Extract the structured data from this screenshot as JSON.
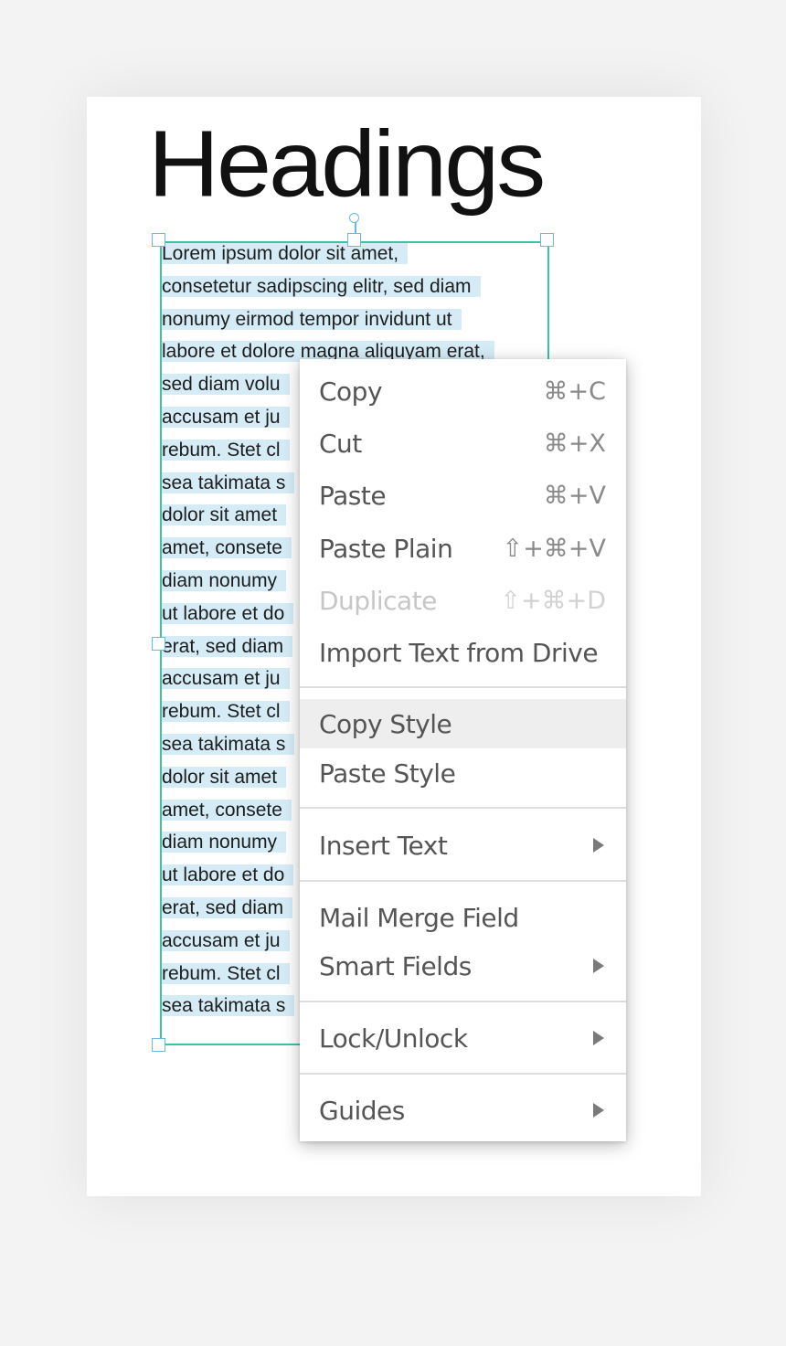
{
  "heading": "Headings",
  "body_lines": [
    "Lorem ipsum dolor sit amet,",
    "consetetur sadipscing elitr, sed diam",
    "nonumy eirmod tempor invidunt ut",
    "labore et dolore magna aliquyam erat,",
    "sed diam volu",
    "accusam et ju",
    "rebum. Stet cl",
    "sea takimata s",
    "dolor sit amet",
    "amet, consete",
    "diam nonumy",
    "ut labore et do",
    "erat, sed diam",
    "accusam et ju",
    "rebum. Stet cl",
    "sea takimata s",
    "dolor sit amet",
    "amet, consete",
    "diam nonumy",
    "ut labore et do",
    "erat, sed diam",
    "accusam et ju",
    "rebum. Stet cl",
    "sea takimata s"
  ],
  "context_menu": {
    "copy": {
      "label": "Copy",
      "shortcut": "⌘+C"
    },
    "cut": {
      "label": "Cut",
      "shortcut": "⌘+X"
    },
    "paste": {
      "label": "Paste",
      "shortcut": "⌘+V"
    },
    "paste_plain": {
      "label": "Paste Plain",
      "shortcut": "⇧+⌘+V"
    },
    "duplicate": {
      "label": "Duplicate",
      "shortcut": "⇧+⌘+D",
      "disabled": true
    },
    "import_text": {
      "label": "Import Text from Drive"
    },
    "copy_style": {
      "label": "Copy Style",
      "highlighted": true
    },
    "paste_style": {
      "label": "Paste Style"
    },
    "insert_text": {
      "label": "Insert Text",
      "submenu": true
    },
    "mail_merge": {
      "label": "Mail Merge Field"
    },
    "smart_fields": {
      "label": "Smart Fields",
      "submenu": true
    },
    "lock_unlock": {
      "label": "Lock/Unlock",
      "submenu": true
    },
    "guides": {
      "label": "Guides",
      "submenu": true
    }
  },
  "colors": {
    "selection_border": "#3ec3a2",
    "text_highlight": "#d5ecf7",
    "handle": "#66b9e8"
  }
}
